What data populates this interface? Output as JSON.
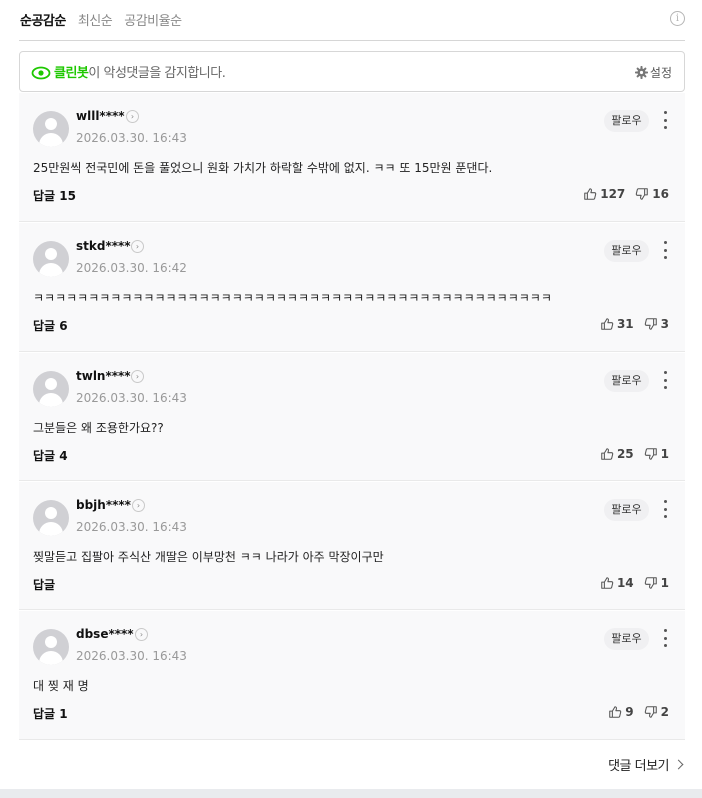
{
  "sort_tabs": [
    {
      "label": "순공감순",
      "active": true
    },
    {
      "label": "최신순",
      "active": false
    },
    {
      "label": "공감비율순",
      "active": false
    }
  ],
  "info_icon": "info-icon",
  "cleanbot": {
    "name": "클린봇",
    "message": "이 악성댓글을 감지합니다.",
    "settings_label": "설정",
    "accent_color": "#1ec800"
  },
  "comments": [
    {
      "nick": "wlll****",
      "date": "2026.03.30. 16:43",
      "follow": "팔로우",
      "text": "25만원씩 전국민에 돈을 풀었으니 원화 가치가 하락할 수밖에 없지. ㅋㅋ 또 15만원 푼댄다.",
      "reply_label": "답글",
      "reply_count": "15",
      "likes": "127",
      "dislikes": "16"
    },
    {
      "nick": "stkd****",
      "date": "2026.03.30. 16:42",
      "follow": "팔로우",
      "text": "ㅋㅋㅋㅋㅋㅋㅋㅋㅋㅋㅋㅋㅋㅋㅋㅋㅋㅋㅋㅋㅋㅋㅋㅋㅋㅋㅋㅋㅋㅋㅋㅋㅋㅋㅋㅋㅋㅋㅋㅋㅋㅋㅋㅋㅋㅋㅋ",
      "reply_label": "답글",
      "reply_count": "6",
      "likes": "31",
      "dislikes": "3"
    },
    {
      "nick": "twln****",
      "date": "2026.03.30. 16:43",
      "follow": "팔로우",
      "text": "그분들은 왜 조용한가요??",
      "reply_label": "답글",
      "reply_count": "4",
      "likes": "25",
      "dislikes": "1"
    },
    {
      "nick": "bbjh****",
      "date": "2026.03.30. 16:43",
      "follow": "팔로우",
      "text": "찢말듣고 집팔아 주식산 개딸은 이부망천 ㅋㅋ 나라가 아주 막장이구만",
      "reply_label": "답글",
      "reply_count": "",
      "likes": "14",
      "dislikes": "1"
    },
    {
      "nick": "dbse****",
      "date": "2026.03.30. 16:43",
      "follow": "팔로우",
      "text": "대 찢 재 명",
      "reply_label": "답글",
      "reply_count": "1",
      "likes": "9",
      "dislikes": "2"
    }
  ],
  "more_comments_label": "댓글 더보기"
}
